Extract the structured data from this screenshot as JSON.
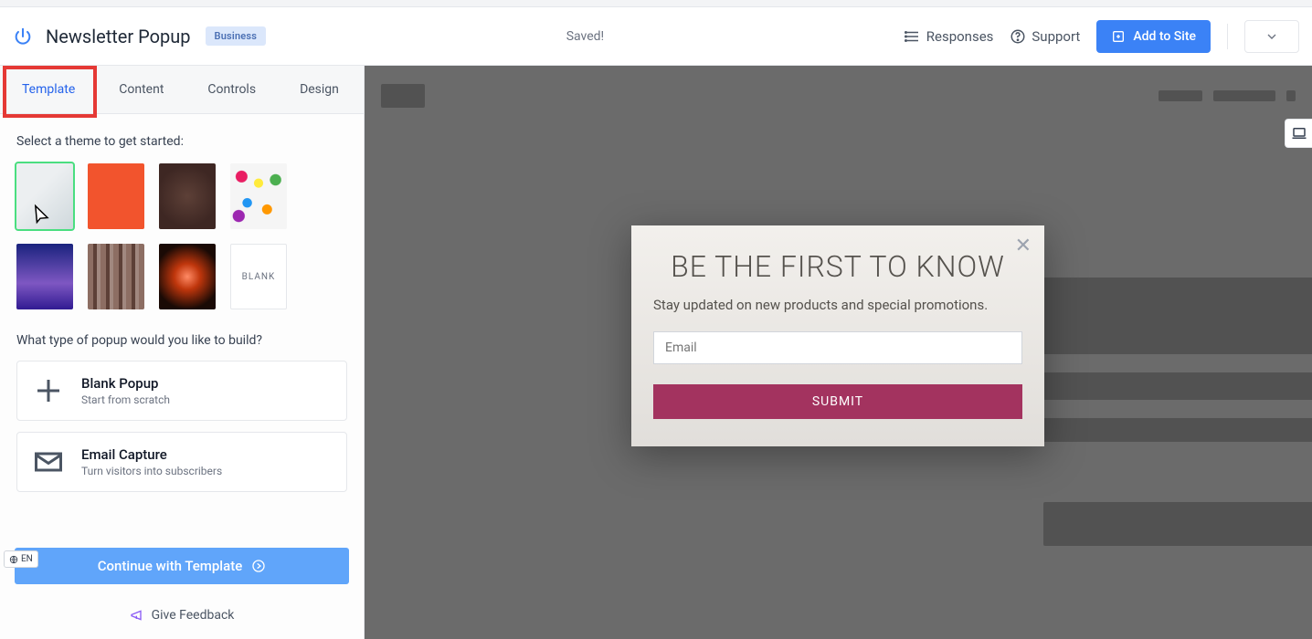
{
  "header": {
    "title": "Newsletter Popup",
    "badge": "Business",
    "saved_status": "Saved!",
    "responses_label": "Responses",
    "support_label": "Support",
    "add_to_site_label": "Add to Site"
  },
  "tabs": {
    "template": "Template",
    "content": "Content",
    "controls": "Controls",
    "design": "Design"
  },
  "panel": {
    "select_theme": "Select a theme to get started:",
    "themes": [
      {
        "name": "light-hangers",
        "selected": true
      },
      {
        "name": "orange"
      },
      {
        "name": "gold-burst"
      },
      {
        "name": "umbrellas"
      },
      {
        "name": "mountains-night"
      },
      {
        "name": "bookshelf"
      },
      {
        "name": "sparkler"
      },
      {
        "name": "blank",
        "label": "BLANK"
      }
    ],
    "popup_type_heading": "What type of popup would you like to build?",
    "options": [
      {
        "title": "Blank Popup",
        "subtitle": "Start from scratch",
        "icon": "plus"
      },
      {
        "title": "Email Capture",
        "subtitle": "Turn visitors into subscribers",
        "icon": "envelope"
      }
    ],
    "continue_label": "Continue with Template",
    "feedback_label": "Give Feedback",
    "lang_badge": "EN"
  },
  "popup": {
    "heading": "BE THE FIRST TO KNOW",
    "subheading": "Stay updated on new products and special promotions.",
    "email_placeholder": "Email",
    "submit_label": "SUBMIT"
  }
}
